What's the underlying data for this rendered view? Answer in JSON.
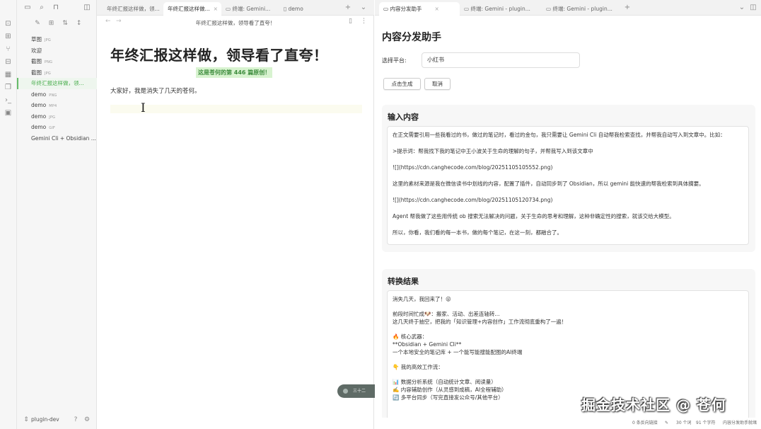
{
  "explorer": {
    "files": [
      {
        "name": "草图",
        "ext": "JPG"
      },
      {
        "name": "欢迎",
        "ext": ""
      },
      {
        "name": "截图",
        "ext": "PNG"
      },
      {
        "name": "截图",
        "ext": "JPG"
      },
      {
        "name": "年终汇报这样做，领...",
        "ext": "",
        "active": true
      },
      {
        "name": "demo",
        "ext": "PNG"
      },
      {
        "name": "demo",
        "ext": "MP4"
      },
      {
        "name": "demo",
        "ext": "JPG"
      },
      {
        "name": "demo",
        "ext": "GIF"
      },
      {
        "name": "Gemini Cli + Obsidian ...",
        "ext": ""
      }
    ],
    "vault_name": "plugin-dev"
  },
  "left_tabs": [
    {
      "label": "年终汇报这样做，领..."
    },
    {
      "label": "年终汇报这样做..."
    },
    {
      "label": "终端: Gemini..."
    },
    {
      "label": "demo"
    }
  ],
  "editor": {
    "breadcrumb": "年终汇报这样做，领导看了直夸！",
    "title": "年终汇报这样做，领导看了直夸！",
    "highlight": "这是苍何的第 446 篇原创！",
    "paragraph": "大家好，我是消失了几天的苍何。",
    "floating_pill": "三十二"
  },
  "right_tabs": [
    {
      "label": "内容分发助手"
    },
    {
      "label": "终端: Gemini - plugin..."
    },
    {
      "label": "终端: Gemini - plugin..."
    }
  ],
  "plugin": {
    "title": "内容分发助手",
    "platform_label": "选择平台:",
    "platform_value": "小红书",
    "generate_button": "点击生成",
    "cancel_button": "取消",
    "input_header": "输入内容",
    "input_paragraphs": [
      "在正文需要引用一些我看过的书，做过的笔记时，看过的金句，我只需要让 Gemini Cli 自动帮我检索查找，并帮我自动写入到文章中。比如：",
      ">提示词：帮我找下我的笔记中王小波关于生命的理解的句子，并帮我写入到该文章中",
      "![](https://cdn.canghecode.com/blog/20251105105552.png)",
      "这里的素材来源是我在微信读书中划线的内容，配置了插件，自动同步到了 Obsidian，所以 gemini 能快速的帮我检索到具体摘要。",
      "![](https://cdn.canghecode.com/blog/20251105120734.png)",
      "Agent 帮我做了这些用传统 ob 搜索无法解决的问题，关于生命的思考和理解，这种非确定性的搜索，就该交给大模型。",
      "所以，你看，我们看的每一本书，做的每个笔记，在这一刻，都融合了。"
    ],
    "result_header": "转换结果",
    "result_lines": [
      "消失几天，我回来了！😜",
      "",
      "前段时间忙成🐶：搬家、活动、出差连轴转...",
      "这几天终于抽空，把我的「知识管理+内容创作」工作流彻底重构了一遍！",
      "",
      "🔥 核心武器：",
      "**Obsidian + Gemini Cli**",
      "一个本地安全的笔记库 + 一个能写能搜能配图的AI终端",
      "",
      "👇 我的高效工作流：",
      "",
      "📊 数据分析系统（自动统计文章、阅读量）",
      "✍️ 内容辅助创作（从灵感到成稿，AI全程辅助）",
      "🔄 多平台同步（写完直接发公众号/其他平台）"
    ]
  },
  "statusbar": {
    "backlinks": "0 条反向链接",
    "words": "30 个词",
    "chars": "91 个字符",
    "plugin_status": "内容分发助手就绪"
  },
  "watermark": "掘金技术社区 @ 苍何",
  "colors": {
    "accent_green": "#4caf50",
    "highlight_bg": "#d8f3d0"
  }
}
